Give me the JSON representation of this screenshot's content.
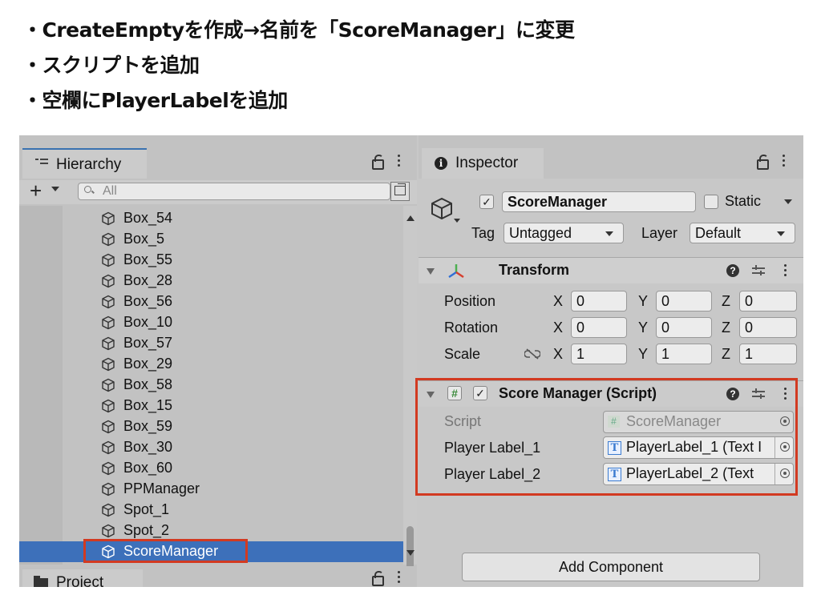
{
  "notes": [
    "・CreateEmptyを作成→名前を「ScoreManager」に変更",
    "・スクリプトを追加",
    "・空欄にPlayerLabelを追加"
  ],
  "hierarchy": {
    "tab_label": "Hierarchy",
    "search_placeholder": "All",
    "items": [
      {
        "label": "Box_54"
      },
      {
        "label": "Box_5"
      },
      {
        "label": "Box_55"
      },
      {
        "label": "Box_28"
      },
      {
        "label": "Box_56"
      },
      {
        "label": "Box_10"
      },
      {
        "label": "Box_57"
      },
      {
        "label": "Box_29"
      },
      {
        "label": "Box_58"
      },
      {
        "label": "Box_15"
      },
      {
        "label": "Box_59"
      },
      {
        "label": "Box_30"
      },
      {
        "label": "Box_60"
      },
      {
        "label": "PPManager"
      },
      {
        "label": "Spot_1"
      },
      {
        "label": "Spot_2"
      },
      {
        "label": "ScoreManager",
        "selected": true
      }
    ]
  },
  "project": {
    "tab_label": "Project"
  },
  "inspector": {
    "tab_label": "Inspector",
    "object_name": "ScoreManager",
    "active": true,
    "static_label": "Static",
    "static_checked": false,
    "tag_label": "Tag",
    "tag_value": "Untagged",
    "layer_label": "Layer",
    "layer_value": "Default",
    "transform": {
      "title": "Transform",
      "rows": [
        {
          "label": "Position",
          "x": "0",
          "y": "0",
          "z": "0"
        },
        {
          "label": "Rotation",
          "x": "0",
          "y": "0",
          "z": "0"
        },
        {
          "label": "Scale",
          "x": "1",
          "y": "1",
          "z": "1"
        }
      ],
      "axis_x": "X",
      "axis_y": "Y",
      "axis_z": "Z"
    },
    "score_manager": {
      "title": "Score Manager (Script)",
      "enabled": true,
      "script_label": "Script",
      "script_value": "ScoreManager",
      "player_label_1_label": "Player Label_1",
      "player_label_1_value": "PlayerLabel_1 (Text I",
      "player_label_2_label": "Player Label_2",
      "player_label_2_value": "PlayerLabel_2 (Text"
    },
    "add_component_label": "Add Component"
  },
  "colors": {
    "selection": "#3d70ba",
    "highlight_border": "#d23a21",
    "tab_accent": "#3a72b0"
  }
}
